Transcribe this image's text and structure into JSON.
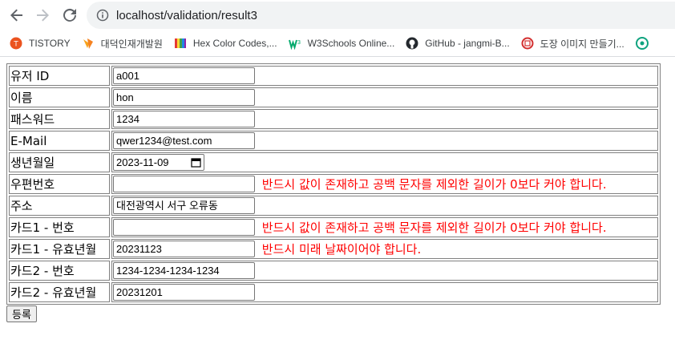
{
  "browser": {
    "url": "localhost/validation/result3",
    "bookmarks": [
      {
        "label": "TISTORY",
        "icon": "tistory-icon"
      },
      {
        "label": "대덕인재개발원",
        "icon": "ddit-icon"
      },
      {
        "label": "Hex Color Codes,...",
        "icon": "hex-color-icon"
      },
      {
        "label": "W3Schools Online...",
        "icon": "w3schools-icon"
      },
      {
        "label": "GitHub - jangmi-B...",
        "icon": "github-icon"
      },
      {
        "label": "도장 이미지 만들기...",
        "icon": "stamp-icon"
      }
    ]
  },
  "form": {
    "rows": [
      {
        "label": "유저 ID",
        "value": "a001",
        "error": ""
      },
      {
        "label": "이름",
        "value": "hon",
        "error": ""
      },
      {
        "label": "패스워드",
        "value": "1234",
        "error": ""
      },
      {
        "label": "E-Mail",
        "value": "qwer1234@test.com",
        "error": ""
      },
      {
        "label": "생년월일",
        "value": "2023-11-09",
        "error": ""
      },
      {
        "label": "우편번호",
        "value": "",
        "error": "반드시 값이 존재하고 공백 문자를 제외한 길이가 0보다 커야 합니다."
      },
      {
        "label": "주소",
        "value": "대전광역시 서구 오류동",
        "error": ""
      },
      {
        "label": "카드1 - 번호",
        "value": "",
        "error": "반드시 값이 존재하고 공백 문자를 제외한 길이가 0보다 커야 합니다."
      },
      {
        "label": "카드1 - 유효년월",
        "value": "20231123",
        "error": "반드시 미래 날짜이어야 합니다."
      },
      {
        "label": "카드2 - 번호",
        "value": "1234-1234-1234-1234",
        "error": ""
      },
      {
        "label": "카드2 - 유효년월",
        "value": "20231201",
        "error": ""
      }
    ],
    "submit_label": "등록"
  },
  "colors": {
    "error": "#ff0000",
    "border": "#808080"
  }
}
